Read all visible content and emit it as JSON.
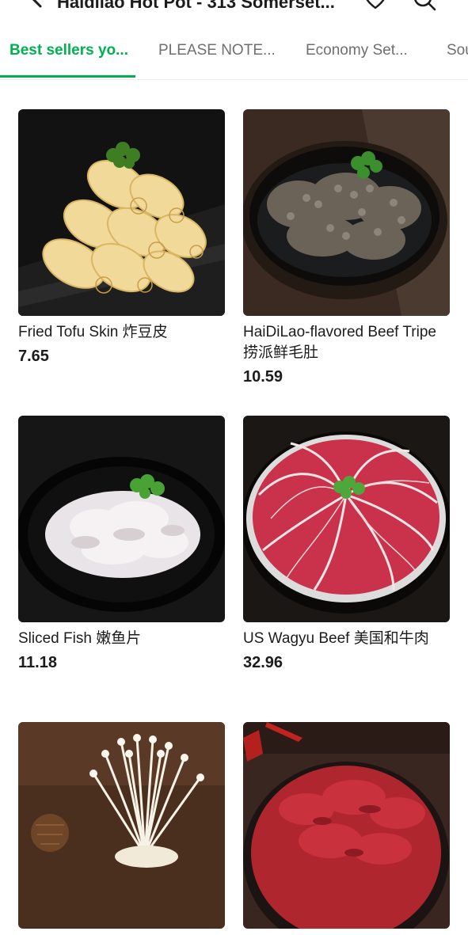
{
  "header": {
    "title": "Haidilao Hot Pot - 313 Somerset..."
  },
  "tabs": [
    {
      "label": "Best sellers yo...",
      "active": true
    },
    {
      "label": "PLEASE NOTE..."
    },
    {
      "label": "Economy Set..."
    },
    {
      "label": "Sou"
    }
  ],
  "products": [
    {
      "name": "Fried Tofu Skin 炸豆皮",
      "price": "7.65"
    },
    {
      "name": "HaiDiLao-flavored Beef Tripe 捞派鲜毛肚",
      "price": "10.59"
    },
    {
      "name": "Sliced Fish 嫩鱼片",
      "price": "11.18"
    },
    {
      "name": "US Wagyu Beef 美国和牛肉",
      "price": "32.96"
    },
    {
      "name": "",
      "price": ""
    },
    {
      "name": "",
      "price": ""
    }
  ],
  "colors": {
    "accent": "#00b14f",
    "text": "#1c1c1c",
    "muted": "#6f6f6f"
  },
  "icons": [
    "back-arrow-icon",
    "heart-icon",
    "search-icon"
  ]
}
